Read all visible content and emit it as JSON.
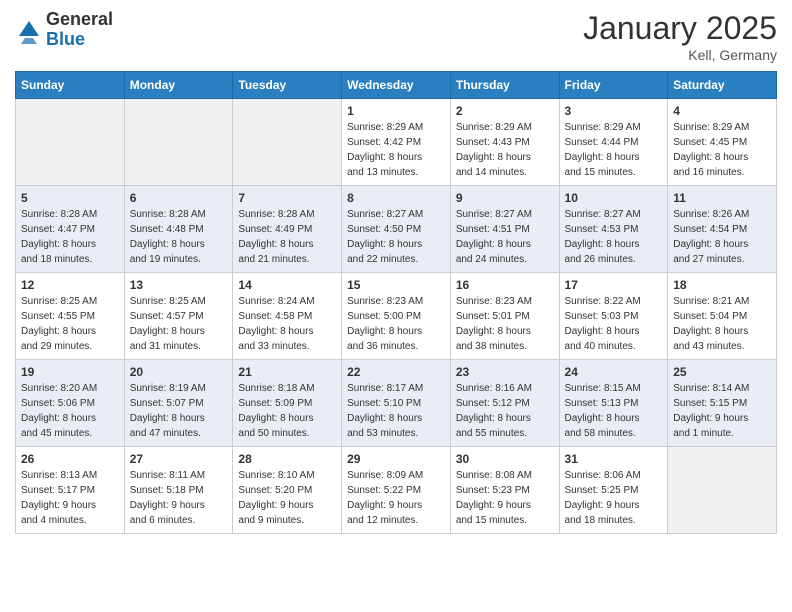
{
  "logo": {
    "general": "General",
    "blue": "Blue"
  },
  "title": "January 2025",
  "location": "Kell, Germany",
  "headers": [
    "Sunday",
    "Monday",
    "Tuesday",
    "Wednesday",
    "Thursday",
    "Friday",
    "Saturday"
  ],
  "weeks": [
    [
      {
        "day": "",
        "info": ""
      },
      {
        "day": "",
        "info": ""
      },
      {
        "day": "",
        "info": ""
      },
      {
        "day": "1",
        "info": "Sunrise: 8:29 AM\nSunset: 4:42 PM\nDaylight: 8 hours\nand 13 minutes."
      },
      {
        "day": "2",
        "info": "Sunrise: 8:29 AM\nSunset: 4:43 PM\nDaylight: 8 hours\nand 14 minutes."
      },
      {
        "day": "3",
        "info": "Sunrise: 8:29 AM\nSunset: 4:44 PM\nDaylight: 8 hours\nand 15 minutes."
      },
      {
        "day": "4",
        "info": "Sunrise: 8:29 AM\nSunset: 4:45 PM\nDaylight: 8 hours\nand 16 minutes."
      }
    ],
    [
      {
        "day": "5",
        "info": "Sunrise: 8:28 AM\nSunset: 4:47 PM\nDaylight: 8 hours\nand 18 minutes."
      },
      {
        "day": "6",
        "info": "Sunrise: 8:28 AM\nSunset: 4:48 PM\nDaylight: 8 hours\nand 19 minutes."
      },
      {
        "day": "7",
        "info": "Sunrise: 8:28 AM\nSunset: 4:49 PM\nDaylight: 8 hours\nand 21 minutes."
      },
      {
        "day": "8",
        "info": "Sunrise: 8:27 AM\nSunset: 4:50 PM\nDaylight: 8 hours\nand 22 minutes."
      },
      {
        "day": "9",
        "info": "Sunrise: 8:27 AM\nSunset: 4:51 PM\nDaylight: 8 hours\nand 24 minutes."
      },
      {
        "day": "10",
        "info": "Sunrise: 8:27 AM\nSunset: 4:53 PM\nDaylight: 8 hours\nand 26 minutes."
      },
      {
        "day": "11",
        "info": "Sunrise: 8:26 AM\nSunset: 4:54 PM\nDaylight: 8 hours\nand 27 minutes."
      }
    ],
    [
      {
        "day": "12",
        "info": "Sunrise: 8:25 AM\nSunset: 4:55 PM\nDaylight: 8 hours\nand 29 minutes."
      },
      {
        "day": "13",
        "info": "Sunrise: 8:25 AM\nSunset: 4:57 PM\nDaylight: 8 hours\nand 31 minutes."
      },
      {
        "day": "14",
        "info": "Sunrise: 8:24 AM\nSunset: 4:58 PM\nDaylight: 8 hours\nand 33 minutes."
      },
      {
        "day": "15",
        "info": "Sunrise: 8:23 AM\nSunset: 5:00 PM\nDaylight: 8 hours\nand 36 minutes."
      },
      {
        "day": "16",
        "info": "Sunrise: 8:23 AM\nSunset: 5:01 PM\nDaylight: 8 hours\nand 38 minutes."
      },
      {
        "day": "17",
        "info": "Sunrise: 8:22 AM\nSunset: 5:03 PM\nDaylight: 8 hours\nand 40 minutes."
      },
      {
        "day": "18",
        "info": "Sunrise: 8:21 AM\nSunset: 5:04 PM\nDaylight: 8 hours\nand 43 minutes."
      }
    ],
    [
      {
        "day": "19",
        "info": "Sunrise: 8:20 AM\nSunset: 5:06 PM\nDaylight: 8 hours\nand 45 minutes."
      },
      {
        "day": "20",
        "info": "Sunrise: 8:19 AM\nSunset: 5:07 PM\nDaylight: 8 hours\nand 47 minutes."
      },
      {
        "day": "21",
        "info": "Sunrise: 8:18 AM\nSunset: 5:09 PM\nDaylight: 8 hours\nand 50 minutes."
      },
      {
        "day": "22",
        "info": "Sunrise: 8:17 AM\nSunset: 5:10 PM\nDaylight: 8 hours\nand 53 minutes."
      },
      {
        "day": "23",
        "info": "Sunrise: 8:16 AM\nSunset: 5:12 PM\nDaylight: 8 hours\nand 55 minutes."
      },
      {
        "day": "24",
        "info": "Sunrise: 8:15 AM\nSunset: 5:13 PM\nDaylight: 8 hours\nand 58 minutes."
      },
      {
        "day": "25",
        "info": "Sunrise: 8:14 AM\nSunset: 5:15 PM\nDaylight: 9 hours\nand 1 minute."
      }
    ],
    [
      {
        "day": "26",
        "info": "Sunrise: 8:13 AM\nSunset: 5:17 PM\nDaylight: 9 hours\nand 4 minutes."
      },
      {
        "day": "27",
        "info": "Sunrise: 8:11 AM\nSunset: 5:18 PM\nDaylight: 9 hours\nand 6 minutes."
      },
      {
        "day": "28",
        "info": "Sunrise: 8:10 AM\nSunset: 5:20 PM\nDaylight: 9 hours\nand 9 minutes."
      },
      {
        "day": "29",
        "info": "Sunrise: 8:09 AM\nSunset: 5:22 PM\nDaylight: 9 hours\nand 12 minutes."
      },
      {
        "day": "30",
        "info": "Sunrise: 8:08 AM\nSunset: 5:23 PM\nDaylight: 9 hours\nand 15 minutes."
      },
      {
        "day": "31",
        "info": "Sunrise: 8:06 AM\nSunset: 5:25 PM\nDaylight: 9 hours\nand 18 minutes."
      },
      {
        "day": "",
        "info": ""
      }
    ]
  ]
}
